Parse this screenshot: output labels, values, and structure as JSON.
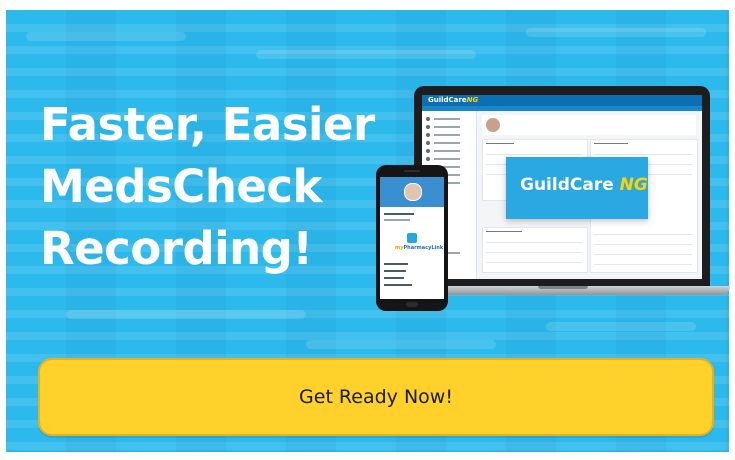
{
  "headline": {
    "lines": [
      "Faster, Easier",
      "MedsCheck",
      "Recording!"
    ]
  },
  "cta": {
    "label": "Get Ready Now!"
  },
  "laptop_screen": {
    "brand_name": "GuildCare",
    "brand_suffix": "NG",
    "banner_brand": "GuildCare",
    "banner_suffix": "NG"
  },
  "phone_screen": {
    "app_prefix": "my",
    "app_name": "PharmacyLink"
  },
  "colors": {
    "background": "#2cb9ec",
    "button": "#ffd12a",
    "headline": "#ffffff",
    "accent": "#ffd200"
  }
}
